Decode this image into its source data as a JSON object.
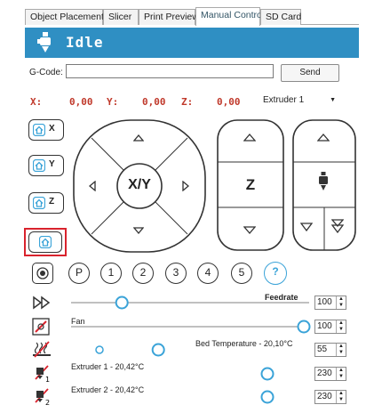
{
  "tabs": [
    {
      "label": "Object Placement"
    },
    {
      "label": "Slicer"
    },
    {
      "label": "Print Preview"
    },
    {
      "label": "Manual Control"
    },
    {
      "label": "SD Card"
    }
  ],
  "status": {
    "text": "Idle"
  },
  "gcode": {
    "label": "G-Code:",
    "value": "",
    "send_label": "Send"
  },
  "coords": {
    "x_label": "X:",
    "x_value": "0,00",
    "y_label": "Y:",
    "y_value": "0,00",
    "z_label": "Z:",
    "z_value": "0,00"
  },
  "extruder_select": {
    "selected": "Extruder 1"
  },
  "home_buttons": {
    "x": "X",
    "y": "Y",
    "z": "Z"
  },
  "xy_pad": {
    "center_label": "X/Y"
  },
  "z_pad": {
    "center_label": "Z"
  },
  "speed_buttons": [
    "P",
    "1",
    "2",
    "3",
    "4",
    "5",
    "?"
  ],
  "sliders": {
    "feedrate": {
      "label": "Feedrate",
      "value": "100",
      "level": 0.2
    },
    "fan": {
      "label": "Fan",
      "value": "100",
      "level": 1.0
    },
    "bed": {
      "label": "Bed Temperature - 20,10°C",
      "value": "55",
      "level": 0.36
    },
    "ext1": {
      "label": "Extruder 1 - 20,42°C",
      "value": "230",
      "level": 0.84
    },
    "ext2": {
      "label": "Extruder 2 - 20,42°C",
      "value": "230",
      "level": 0.84
    }
  },
  "colors": {
    "status_bar": "#2f8fc3",
    "accent": "#3aa3d8",
    "highlight": "#d9232d"
  }
}
